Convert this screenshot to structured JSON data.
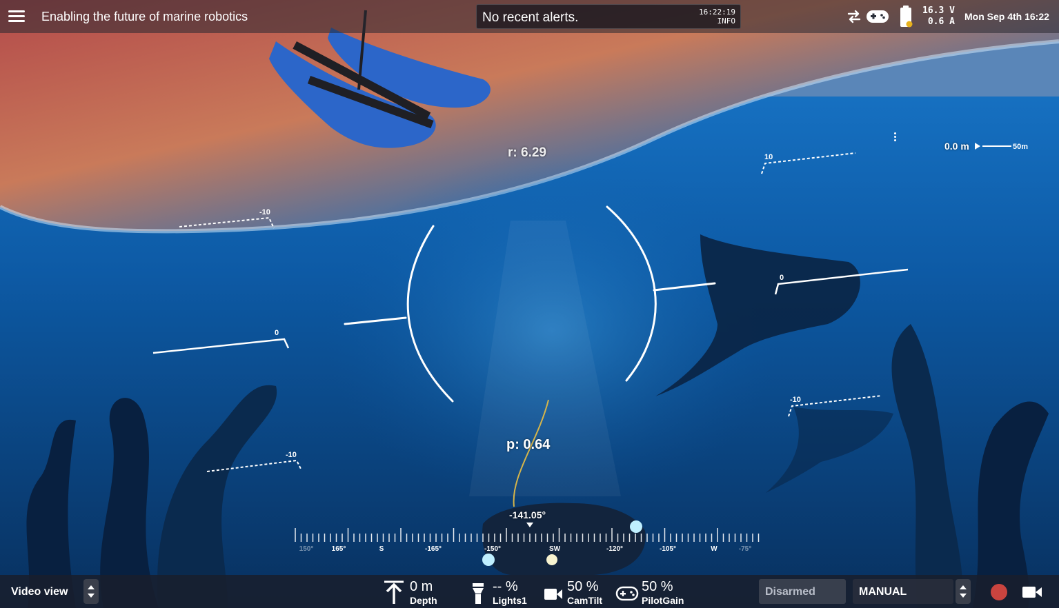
{
  "topbar": {
    "title": "Enabling the future of marine robotics",
    "alert": {
      "message": "No recent alerts.",
      "time": "16:22:19",
      "level": "INFO"
    },
    "battery": {
      "voltage": "16.3 V",
      "current": "0.6 A"
    },
    "datetime": "Mon Sep 4th 16:22",
    "icons": [
      "menu-icon",
      "connection-arrows-icon",
      "joystick-icon",
      "battery-icon"
    ]
  },
  "hud": {
    "roll": "r: 6.29",
    "pitch": "p: 0.64",
    "heading": "-141.05°",
    "distance": "0.0 m",
    "distance_scale": "50m",
    "pitch_ladder_labels": {
      "upper": "10",
      "middle": "0",
      "lower": "-10"
    },
    "compass_ticks": [
      "150°",
      "165°",
      "S",
      "-165°",
      "-150°",
      "SW",
      "-120°",
      "-105°",
      "W",
      "-75°"
    ]
  },
  "bottombar": {
    "view": "Video view",
    "widgets": [
      {
        "icon": "anchor-depth-icon",
        "value": "0 m",
        "label": "Depth"
      },
      {
        "icon": "flashlight-icon",
        "value": "-- %",
        "label": "Lights1"
      },
      {
        "icon": "camera-icon",
        "value": "50 %",
        "label": "CamTilt"
      },
      {
        "icon": "gamepad-icon",
        "value": "50 %",
        "label": "PilotGain"
      }
    ],
    "arm_state": "Disarmed",
    "mode": "MANUAL"
  },
  "colors": {
    "record": "#c9443f",
    "water": "#0b3f78",
    "sunset": "#f08b3a",
    "boat": "#2c66c9"
  }
}
